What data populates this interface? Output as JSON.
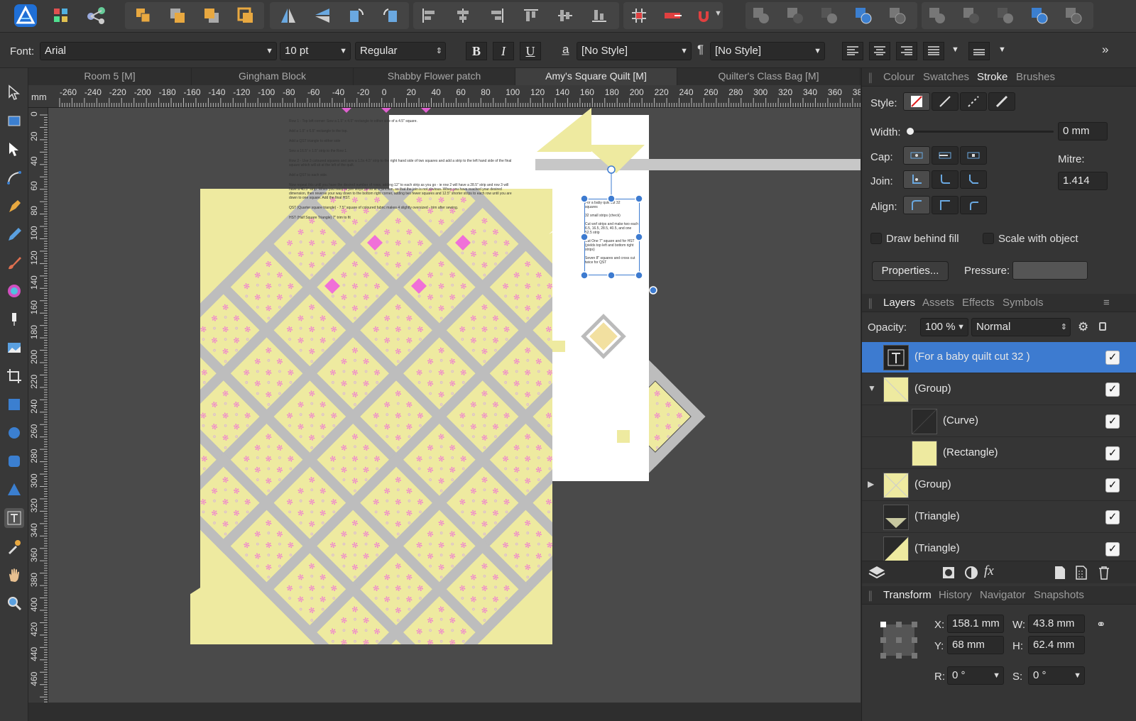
{
  "app": {
    "accent": "#3d7bd0"
  },
  "toolbar": {
    "icons": [
      "affinity-logo",
      "persona-grid",
      "share-nodes",
      "arrange-front",
      "arrange-forward",
      "arrange-back",
      "arrange-backmost",
      "flip-horizontal",
      "flip-vertical",
      "rotate-left",
      "rotate-right",
      "align-left",
      "align-center",
      "align-right",
      "align-top",
      "align-middle",
      "align-bottom",
      "snapping-grid",
      "move-to-layer",
      "snapping-magnet",
      "boolean-add",
      "boolean-subtract",
      "boolean-intersect",
      "boolean-xor",
      "boolean-divide",
      "geometry-add",
      "geometry-subtract",
      "geometry-intersect",
      "geometry-xor",
      "geometry-divide"
    ]
  },
  "context": {
    "font_label": "Font:",
    "font": "Arial",
    "size": "10 pt",
    "weight": "Regular",
    "bold": "B",
    "italic": "I",
    "underline": "U",
    "char_style": "[No Style]",
    "para_style": "[No Style]"
  },
  "tabs": [
    {
      "label": "Room 5 [M]"
    },
    {
      "label": "Gingham Block"
    },
    {
      "label": "Shabby Flower patch"
    },
    {
      "label": "Amy's Square Quilt [M]",
      "active": true
    },
    {
      "label": "Quilter's Class Bag [M]"
    }
  ],
  "ruler": {
    "unit": "mm",
    "h_ticks": [
      "-260",
      "-240",
      "-220",
      "-200",
      "-180",
      "-160",
      "-140",
      "-120",
      "-100",
      "-80",
      "-60",
      "-40",
      "-20",
      "0",
      "20",
      "40",
      "60",
      "80",
      "100",
      "120",
      "140",
      "160",
      "180",
      "200",
      "220",
      "240",
      "260",
      "280",
      "300",
      "320",
      "340",
      "360",
      "38"
    ],
    "v_ticks": [
      "0",
      "20",
      "40",
      "60",
      "80",
      "100",
      "120",
      "140",
      "160",
      "180",
      "200",
      "220",
      "240",
      "260",
      "280",
      "300",
      "320",
      "340",
      "360",
      "380",
      "400",
      "420",
      "440",
      "460"
    ]
  },
  "canvas": {
    "fabric_color": "#eeeaa0",
    "strip_color": "#bdbdbd",
    "pink": "#f080d0",
    "doc_notes": [
      "Row 1 - Top left corner: Sew a 1.5\" x 4.5\" rectangle to either side of a 4.5\" square.",
      "Add a 1.5\" x 6.5\" rectangle to the top.",
      "Add a QST triangle to either side",
      "Sew a 16.5\" x 1.5\" strip to the Row 1.",
      "Row 2 - Use 3 coloured squares and sew a 1.5x 4.5\" strip to the right hand side of two squares and add a strip to the left hand side of the final square which will sit at the left of the quilt.",
      "Add a QST to each side.",
      "Now repeat this until you have the desired number of rows, adding 12\" to each strip as you go - ie row 2 will have a 28.5\" strip and row 3 will have a 40.5\" strip. When you need to join strips do so at a junction, so that the join is not obvious. When you have reached your desired dimension, then reverse your way down to the bottom right corner, adding two fewer squares and 12.5\" shorter strips to each row until you are down to one square. Add the final HST.",
      "QST (Quarter square triangle) - 7.5\" square of coloured fabric makes 4 slightly oversized - trim after sewing.",
      "HST (Half Square Triangle) 7\" trim to fit"
    ],
    "selected_text": [
      "For a baby quilt cut  32",
      "squares",
      "32 small strips (check)",
      "Cut  wof strips and make two  each 6.5, 16.5, 28.5, 40.5, and one  52.5 strip",
      "Cut One 7\" square and for HST (yields top left and bottom right strips)",
      "Seven 8\" squares and cross cut twice for QST"
    ]
  },
  "stroke_panel": {
    "tabs": [
      {
        "label": "Colour"
      },
      {
        "label": "Swatches"
      },
      {
        "label": "Stroke",
        "active": true
      },
      {
        "label": "Brushes"
      }
    ],
    "style_label": "Style:",
    "width_label": "Width:",
    "width_value": "0 mm",
    "width_fraction": 0,
    "cap_label": "Cap:",
    "join_label": "Join:",
    "align_label": "Align:",
    "mitre_label": "Mitre:",
    "mitre_value": "1.414",
    "draw_behind": "Draw behind fill",
    "scale_with": "Scale with object",
    "properties": "Properties...",
    "pressure_label": "Pressure:"
  },
  "layers_panel": {
    "tabs": [
      {
        "label": "Layers",
        "active": true
      },
      {
        "label": "Assets"
      },
      {
        "label": "Effects"
      },
      {
        "label": "Symbols"
      }
    ],
    "opacity_label": "Opacity:",
    "opacity": "100 %",
    "blend": "Normal",
    "rows": [
      {
        "name": "(For a baby quilt cut  32 )",
        "thumb": "text",
        "selected": true,
        "indent": 0
      },
      {
        "name": "(Group)",
        "thumb": "yellow-diag",
        "expander": "down",
        "indent": 0
      },
      {
        "name": "(Curve)",
        "thumb": "dark",
        "indent": 1
      },
      {
        "name": "(Rectangle)",
        "thumb": "yellow",
        "indent": 1
      },
      {
        "name": "(Group)",
        "thumb": "yellow-cross",
        "expander": "right",
        "indent": 0
      },
      {
        "name": "(Triangle)",
        "thumb": "triangle-down",
        "indent": 0
      },
      {
        "name": "(Triangle)",
        "thumb": "triangle-half",
        "indent": 0
      }
    ]
  },
  "transform_panel": {
    "tabs": [
      {
        "label": "Transform",
        "active": true
      },
      {
        "label": "History"
      },
      {
        "label": "Navigator"
      },
      {
        "label": "Snapshots"
      }
    ],
    "x_label": "X:",
    "x": "158.1 mm",
    "y_label": "Y:",
    "y": "68 mm",
    "w_label": "W:",
    "w": "43.8 mm",
    "h_label": "H:",
    "h": "62.4 mm",
    "r_label": "R:",
    "r": "0 °",
    "s_label": "S:",
    "s": "0 °"
  }
}
